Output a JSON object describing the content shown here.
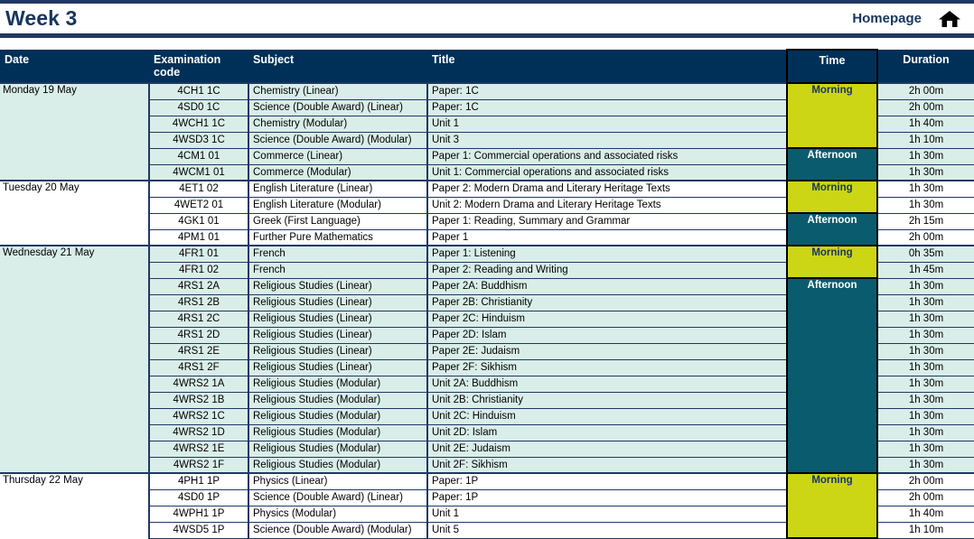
{
  "header": {
    "week_title": "Week 3",
    "homepage_label": "Homepage",
    "home_icon": "home-icon"
  },
  "table": {
    "columns": [
      {
        "key": "date",
        "label": "Date"
      },
      {
        "key": "code",
        "label": "Examination code"
      },
      {
        "key": "subject",
        "label": "Subject"
      },
      {
        "key": "title",
        "label": "Title"
      },
      {
        "key": "time",
        "label": "Time"
      },
      {
        "key": "duration",
        "label": "Duration"
      }
    ],
    "colors": {
      "header_navy": "#003058",
      "morning_yellow": "#ccd614",
      "afternoon_teal": "#0b5b6e",
      "row_mint": "#d9eee8",
      "row_white": "#ffffff",
      "grid_navy": "#1f3864",
      "title_blue": "#17365d"
    },
    "groups": [
      {
        "date": "Monday 19 May",
        "shade": "mint",
        "rows": [
          {
            "code": "4CH1 1C",
            "subject": "Chemistry (Linear)",
            "title": "Paper: 1C",
            "time": "Morning",
            "time_span": 4,
            "duration": "2h 00m"
          },
          {
            "code": "4SD0 1C",
            "subject": "Science (Double Award) (Linear)",
            "title": "Paper: 1C",
            "time": "",
            "time_span": 0,
            "duration": "2h 00m"
          },
          {
            "code": "4WCH1 1C",
            "subject": "Chemistry (Modular)",
            "title": "Unit 1",
            "time": "",
            "time_span": 0,
            "duration": "1h 40m"
          },
          {
            "code": "4WSD3 1C",
            "subject": "Science (Double Award) (Modular)",
            "title": "Unit 3",
            "time": "",
            "time_span": 0,
            "duration": "1h 10m"
          },
          {
            "code": "4CM1 01",
            "subject": "Commerce (Linear)",
            "title": "Paper 1: Commercial operations and associated risks",
            "time": "Afternoon",
            "time_span": 2,
            "duration": "1h 30m"
          },
          {
            "code": "4WCM1 01",
            "subject": "Commerce (Modular)",
            "title": "Unit 1: Commercial operations and associated risks",
            "time": "",
            "time_span": 0,
            "duration": "1h 30m"
          }
        ]
      },
      {
        "date": "Tuesday 20 May",
        "shade": "white",
        "rows": [
          {
            "code": "4ET1 02",
            "subject": "English Literature (Linear)",
            "title": "Paper 2: Modern Drama and Literary Heritage Texts",
            "time": "Morning",
            "time_span": 2,
            "duration": "1h 30m"
          },
          {
            "code": "4WET2 01",
            "subject": "English Literature (Modular)",
            "title": "Unit 2: Modern Drama and Literary Heritage Texts",
            "time": "",
            "time_span": 0,
            "duration": "1h 30m"
          },
          {
            "code": "4GK1 01",
            "subject": "Greek (First Language)",
            "title": "Paper 1: Reading, Summary and Grammar",
            "time": "Afternoon",
            "time_span": 2,
            "duration": "2h 15m"
          },
          {
            "code": "4PM1 01",
            "subject": "Further Pure Mathematics",
            "title": "Paper 1",
            "time": "",
            "time_span": 0,
            "duration": "2h 00m"
          }
        ]
      },
      {
        "date": "Wednesday 21 May",
        "shade": "mint",
        "rows": [
          {
            "code": "4FR1 01",
            "subject": "French",
            "title": "Paper 1: Listening",
            "time": "Morning",
            "time_span": 2,
            "duration": "0h 35m"
          },
          {
            "code": "4FR1 02",
            "subject": "French",
            "title": "Paper 2: Reading and Writing",
            "time": "",
            "time_span": 0,
            "duration": "1h 45m"
          },
          {
            "code": "4RS1 2A",
            "subject": "Religious Studies (Linear)",
            "title": "Paper 2A: Buddhism",
            "time": "Afternoon",
            "time_span": 12,
            "duration": "1h 30m"
          },
          {
            "code": "4RS1 2B",
            "subject": "Religious Studies (Linear)",
            "title": "Paper 2B: Christianity",
            "time": "",
            "time_span": 0,
            "duration": "1h 30m"
          },
          {
            "code": "4RS1 2C",
            "subject": "Religious Studies (Linear)",
            "title": "Paper 2C: Hinduism",
            "time": "",
            "time_span": 0,
            "duration": "1h 30m"
          },
          {
            "code": "4RS1 2D",
            "subject": "Religious Studies (Linear)",
            "title": "Paper 2D: Islam",
            "time": "",
            "time_span": 0,
            "duration": "1h 30m"
          },
          {
            "code": "4RS1 2E",
            "subject": "Religious Studies (Linear)",
            "title": "Paper 2E: Judaism",
            "time": "",
            "time_span": 0,
            "duration": "1h 30m"
          },
          {
            "code": "4RS1 2F",
            "subject": "Religious Studies (Linear)",
            "title": "Paper 2F: Sikhism",
            "time": "",
            "time_span": 0,
            "duration": "1h 30m"
          },
          {
            "code": "4WRS2 1A",
            "subject": "Religious Studies (Modular)",
            "title": "Unit 2A: Buddhism",
            "time": "",
            "time_span": 0,
            "duration": "1h 30m"
          },
          {
            "code": "4WRS2 1B",
            "subject": "Religious Studies (Modular)",
            "title": "Unit 2B: Christianity",
            "time": "",
            "time_span": 0,
            "duration": "1h 30m"
          },
          {
            "code": "4WRS2 1C",
            "subject": "Religious Studies (Modular)",
            "title": "Unit 2C: Hinduism",
            "time": "",
            "time_span": 0,
            "duration": "1h 30m"
          },
          {
            "code": "4WRS2 1D",
            "subject": "Religious Studies (Modular)",
            "title": "Unit 2D: Islam",
            "time": "",
            "time_span": 0,
            "duration": "1h 30m"
          },
          {
            "code": "4WRS2 1E",
            "subject": "Religious Studies (Modular)",
            "title": "Unit 2E: Judaism",
            "time": "",
            "time_span": 0,
            "duration": "1h 30m"
          },
          {
            "code": "4WRS2 1F",
            "subject": "Religious Studies (Modular)",
            "title": "Unit 2F: Sikhism",
            "time": "",
            "time_span": 0,
            "duration": "1h 30m"
          }
        ]
      },
      {
        "date": "Thursday 22 May",
        "shade": "white",
        "rows": [
          {
            "code": "4PH1 1P",
            "subject": "Physics (Linear)",
            "title": "Paper: 1P",
            "time": "Morning",
            "time_span": 4,
            "duration": "2h 00m"
          },
          {
            "code": "4SD0 1P",
            "subject": "Science (Double Award) (Linear)",
            "title": "Paper: 1P",
            "time": "",
            "time_span": 0,
            "duration": "2h 00m"
          },
          {
            "code": "4WPH1 1P",
            "subject": "Physics (Modular)",
            "title": "Unit 1",
            "time": "",
            "time_span": 0,
            "duration": "1h 40m"
          },
          {
            "code": "4WSD5 1P",
            "subject": "Science (Double Award) (Modular)",
            "title": "Unit 5",
            "time": "",
            "time_span": 0,
            "duration": "1h 10m"
          }
        ]
      }
    ]
  }
}
